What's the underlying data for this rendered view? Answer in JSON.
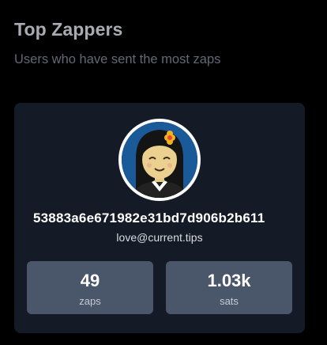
{
  "section": {
    "title": "Top Zappers",
    "subtitle": "Users who have sent the most zaps"
  },
  "zapper": {
    "avatar_icon": "avatar-illustration",
    "pubkey": "53883a6e671982e31bd7d906b2b611",
    "lightning_address": "love@current.tips",
    "stats": {
      "zaps_value": "49",
      "zaps_label": "zaps",
      "sats_value": "1.03k",
      "sats_label": "sats"
    }
  },
  "colors": {
    "background": "#000000",
    "card": "#141b27",
    "stat_box": "#4a5669",
    "avatar_bg": "#1b5a99"
  }
}
